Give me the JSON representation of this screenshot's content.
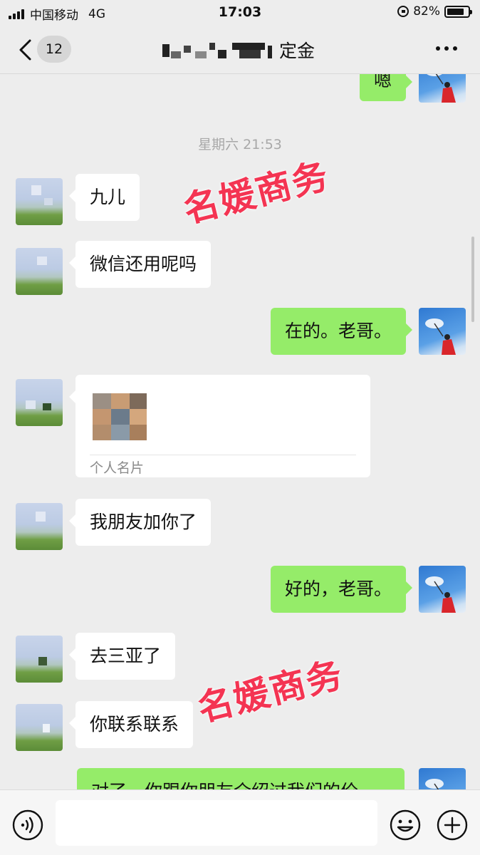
{
  "status_bar": {
    "carrier": "中国移动",
    "network": "4G",
    "time": "17:03",
    "battery": "82%",
    "battery_level": 0.82
  },
  "nav": {
    "unread_count": "12",
    "title_suffix": "定金"
  },
  "chat": {
    "timestamp": "星期六 21:53",
    "messages": [
      {
        "side": "out",
        "text": "嗯"
      },
      {
        "side": "in",
        "text": "九儿"
      },
      {
        "side": "in",
        "text": "微信还用呢吗"
      },
      {
        "side": "out",
        "text": "在的。老哥。"
      },
      {
        "side": "in",
        "type": "contact_card",
        "label": "个人名片"
      },
      {
        "side": "in",
        "text": "我朋友加你了"
      },
      {
        "side": "out",
        "text": "好的，老哥。"
      },
      {
        "side": "in",
        "text": "去三亚了"
      },
      {
        "side": "in",
        "text": "你联系联系"
      },
      {
        "side": "out",
        "text": "对了，你跟你朋友介绍过我们的价"
      }
    ]
  },
  "watermarks": [
    "名媛商务",
    "名媛商务"
  ],
  "colors": {
    "background": "#ededed",
    "bubble_out": "#95ec69",
    "bubble_in": "#ffffff",
    "watermark": "#f2183a"
  },
  "input_bar": {
    "icons": [
      "voice-icon",
      "emoji-icon",
      "plus-icon"
    ]
  }
}
